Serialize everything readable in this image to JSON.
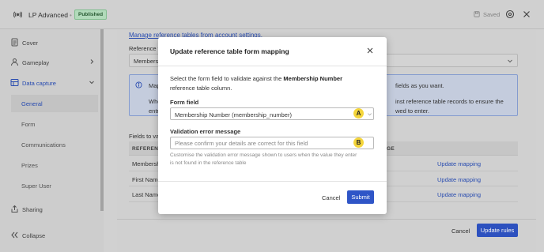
{
  "topbar": {
    "app_title": "LP Advanced",
    "separator": "•",
    "status_badge": "Published",
    "saved_text": "Saved"
  },
  "sidebar": {
    "items": [
      {
        "label": "Cover",
        "icon": "document-icon"
      },
      {
        "label": "Gameplay",
        "icon": "person-icon"
      },
      {
        "label": "Data capture",
        "icon": "data-icon"
      }
    ],
    "sub_items": [
      "General",
      "Form",
      "Communications",
      "Prizes",
      "Super User"
    ],
    "sharing": "Sharing",
    "collapse": "Collapse"
  },
  "content": {
    "manage_link": "Manage reference tables from account settings.",
    "reference_label": "Reference t",
    "reference_value": "Members",
    "info_lines": [
      "Map",
      "Whe",
      "entr"
    ],
    "info_lines_right": [
      "fields as you want.",
      "inst reference table records to ensure the",
      "wed to enter."
    ],
    "fields_label": "Fields to va",
    "table": {
      "headers": [
        "REFERENC",
        "GE"
      ],
      "rows": [
        {
          "name": "Membersh",
          "action": "Update mapping"
        },
        {
          "name": "First Name",
          "action": "Update mapping"
        },
        {
          "name": "Last Name",
          "action": "Update mapping"
        }
      ]
    },
    "cancel_label": "Cancel",
    "update_rules_label": "Update rules"
  },
  "modal": {
    "title": "Update reference table form mapping",
    "desc_prefix": "Select the form field to validate against the ",
    "desc_bold": "Membership Number",
    "desc_line2": "reference table column.",
    "form_field_label": "Form field",
    "form_field_value": "Membership Number (membership_number)",
    "marker_a": "A",
    "validation_label": "Validation error message",
    "validation_placeholder": "Please confirm your details are correct for this field",
    "marker_b": "B",
    "help_line1": "Customise the validation error message shown to users when the value they enter",
    "help_line2": "is not found in the reference table",
    "cancel_label": "Cancel",
    "submit_label": "Submit"
  },
  "colors": {
    "primary": "#2f55c7",
    "link": "#2a4fb8",
    "badge_bg": "#b9e3c2",
    "marker": "#f4d53b"
  }
}
